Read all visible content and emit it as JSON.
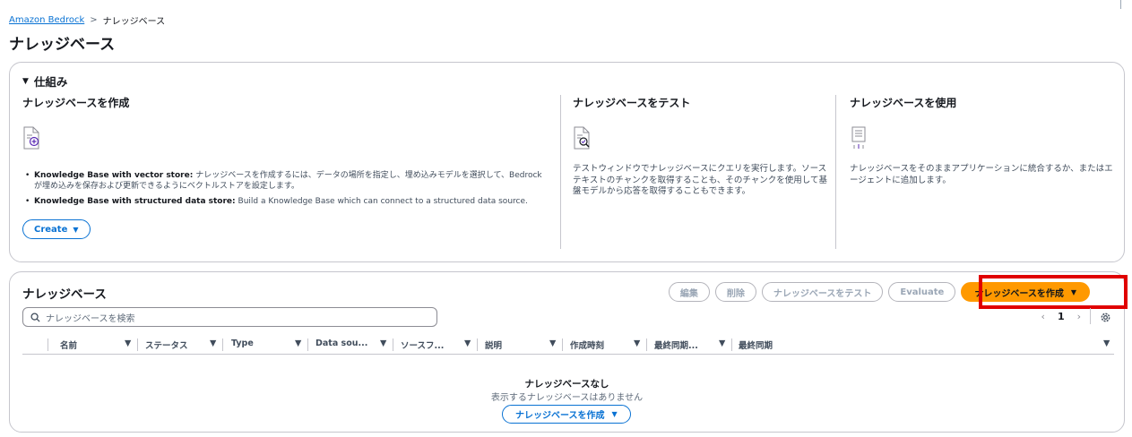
{
  "breadcrumb": {
    "root": "Amazon Bedrock",
    "separator": ">",
    "current": "ナレッジベース"
  },
  "page_title": "ナレッジベース",
  "how_it_works": {
    "header": "仕組み",
    "toggle_icon": "caret-down",
    "create": {
      "title": "ナレッジベースを作成",
      "icon": "document-add-icon",
      "bullets": [
        {
          "label": "Knowledge Base with vector store:",
          "text": "ナレッジベースを作成するには、データの場所を指定し、埋め込みモデルを選択して、Bedrock が埋め込みを保存および更新できるようにベクトルストアを設定します。"
        },
        {
          "label": "Knowledge Base with structured data store:",
          "text": "Build a Knowledge Base which can connect to a structured data source."
        }
      ],
      "button": "Create"
    },
    "test": {
      "title": "ナレッジベースをテスト",
      "icon": "document-search-icon",
      "text": "テストウィンドウでナレッジベースにクエリを実行します。ソーステキストのチャンクを取得することも、そのチャンクを使用して基盤モデルから応答を取得することもできます。"
    },
    "use": {
      "title": "ナレッジベースを使用",
      "icon": "document-use-icon",
      "text": "ナレッジベースをそのままアプリケーションに統合するか、またはエージェントに追加します。"
    }
  },
  "kb_table": {
    "title": "ナレッジベース",
    "actions": {
      "edit": "編集",
      "delete": "削除",
      "test": "ナレッジベースをテスト",
      "evaluate": "Evaluate",
      "create": "ナレッジベースを作成"
    },
    "search_placeholder": "ナレッジベースを検索",
    "pagination": {
      "prev": "‹",
      "page": "1",
      "next": "›"
    },
    "columns": [
      "名前",
      "ステータス",
      "Type",
      "Data sou...",
      "ソースフ...",
      "説明",
      "作成時刻",
      "最終同期...",
      "最終同期"
    ],
    "empty": {
      "title": "ナレッジベースなし",
      "subtitle": "表示するナレッジベースはありません",
      "button": "ナレッジベースを作成"
    }
  },
  "colors": {
    "accent": "#0972d3",
    "primary": "#ff9900",
    "highlight": "#e00000",
    "border": "#c6c6cd"
  }
}
